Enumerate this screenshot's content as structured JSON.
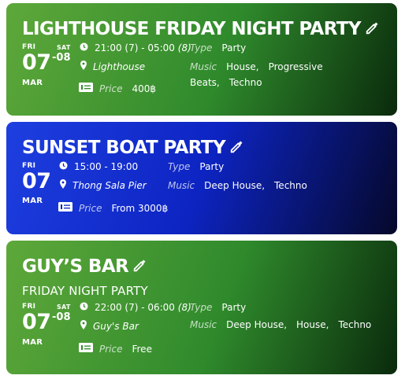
{
  "events": [
    {
      "title": "LIGHTHOUSE FRIDAY NIGHT PARTY",
      "subtitle": "",
      "start_dow": "FRI",
      "start_day": "07",
      "end_dow": "SAT",
      "end_day": "-08",
      "month": "MAR",
      "time": "21:00 (7) - 05:00",
      "duration": "(8)",
      "location": "Lighthouse",
      "price_label": "Price",
      "price": "400฿",
      "type_label": "Type",
      "type": "Party",
      "music_label": "Music",
      "music": [
        "House,",
        "Progressive Beats,",
        "Techno"
      ]
    },
    {
      "title": "SUNSET BOAT PARTY",
      "subtitle": "",
      "start_dow": "FRI",
      "start_day": "07",
      "month": "MAR",
      "time": "15:00 - 19:00",
      "location": "Thong Sala Pier",
      "price_label": "Price",
      "price": "From 3000฿",
      "type_label": "Type",
      "type": "Party",
      "music_label": "Music",
      "music": [
        "Deep House,",
        "Techno"
      ]
    },
    {
      "title": "GUY’S BAR",
      "subtitle": "FRIDAY NIGHT PARTY",
      "start_dow": "FRI",
      "start_day": "07",
      "end_dow": "SAT",
      "end_day": "-08",
      "month": "MAR",
      "time": "22:00 (7) - 06:00",
      "duration": "(8)",
      "location": "Guy's Bar",
      "price_label": "Price",
      "price": "Free",
      "type_label": "Type",
      "type": "Party",
      "music_label": "Music",
      "music": [
        "Deep House,",
        "House,",
        "Techno"
      ]
    }
  ],
  "colors": {
    "green_card": "#2f8a2c",
    "blue_card": "#0d24c2",
    "text": "#ffffff"
  },
  "icons": [
    "pencil-icon",
    "clock-icon",
    "map-pin-icon",
    "cash-icon"
  ]
}
